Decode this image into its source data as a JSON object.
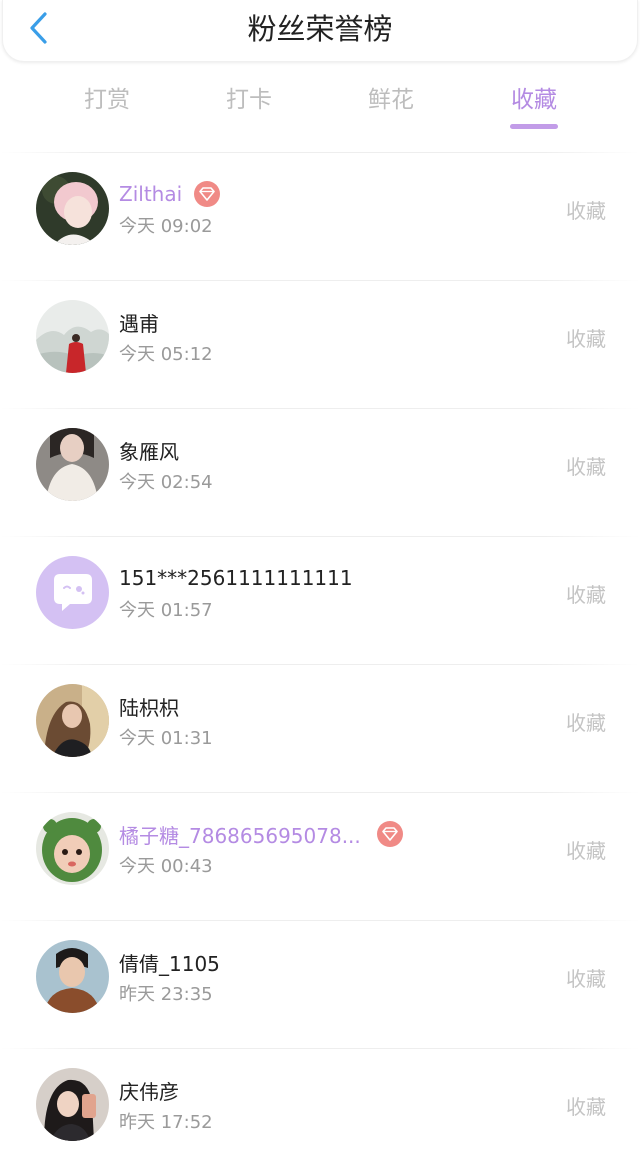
{
  "header": {
    "title": "粉丝荣誉榜"
  },
  "tabs": [
    {
      "label": "打赏"
    },
    {
      "label": "打卡"
    },
    {
      "label": "鲜花"
    },
    {
      "label": "收藏"
    }
  ],
  "active_tab_index": 3,
  "colors": {
    "accent": "#b48be3",
    "back_icon": "#3a9ee8",
    "vip_badge": "#f08a86",
    "muted_text": "#9a9a9a",
    "action_text": "#c4c4c4"
  },
  "fans": [
    {
      "name": "Zilthai",
      "vip": true,
      "time": "今天 09:02",
      "action": "收藏",
      "avatar_icon": "avatar-pink-hair"
    },
    {
      "name": "遇甫",
      "vip": false,
      "time": "今天 05:12",
      "action": "收藏",
      "avatar_icon": "avatar-red-cloak-landscape"
    },
    {
      "name": "象雁风",
      "vip": false,
      "time": "今天 02:54",
      "action": "收藏",
      "avatar_icon": "avatar-girl-white-top"
    },
    {
      "name": "151***2561111111111",
      "vip": false,
      "time": "今天 01:57",
      "action": "收藏",
      "avatar_icon": "avatar-default-chat-bubble"
    },
    {
      "name": "陆枳枳",
      "vip": false,
      "time": "今天 01:31",
      "action": "收藏",
      "avatar_icon": "avatar-girl-long-hair"
    },
    {
      "name": "橘子糖_786865695078...",
      "vip": true,
      "time": "今天 00:43",
      "action": "收藏",
      "avatar_icon": "avatar-green-hood"
    },
    {
      "name": "倩倩_1105",
      "vip": false,
      "time": "昨天 23:35",
      "action": "收藏",
      "avatar_icon": "avatar-boy-brown-shirt"
    },
    {
      "name": "庆伟彦",
      "vip": false,
      "time": "昨天 17:52",
      "action": "收藏",
      "avatar_icon": "avatar-girl-selfie"
    }
  ]
}
